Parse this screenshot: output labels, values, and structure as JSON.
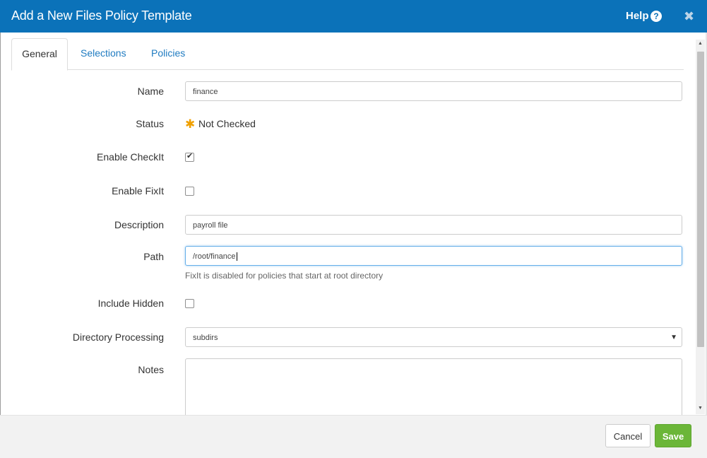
{
  "dialog": {
    "title": "Add a New Files Policy Template",
    "help_label": "Help",
    "help_icon": "?",
    "close_icon": "✖"
  },
  "tabs": [
    {
      "label": "General",
      "active": true
    },
    {
      "label": "Selections",
      "active": false
    },
    {
      "label": "Policies",
      "active": false
    }
  ],
  "form": {
    "name": {
      "label": "Name",
      "value": "finance"
    },
    "status": {
      "label": "Status",
      "icon": "asterisk-icon",
      "value": "Not Checked"
    },
    "enable_checkit": {
      "label": "Enable CheckIt",
      "checked": true
    },
    "enable_fixit": {
      "label": "Enable FixIt",
      "checked": false
    },
    "description": {
      "label": "Description",
      "value": "payroll file"
    },
    "path": {
      "label": "Path",
      "value": "/root/finance",
      "help": "FixIt is disabled for policies that start at root directory"
    },
    "include_hidden": {
      "label": "Include Hidden",
      "checked": false
    },
    "directory_processing": {
      "label": "Directory Processing",
      "value": "subdirs"
    },
    "notes": {
      "label": "Notes",
      "value": ""
    }
  },
  "footer": {
    "cancel_label": "Cancel",
    "save_label": "Save"
  },
  "colors": {
    "header": "#0b72b9",
    "link": "#1f7bc1",
    "save": "#6bb638",
    "status_star": "#f0a000"
  }
}
